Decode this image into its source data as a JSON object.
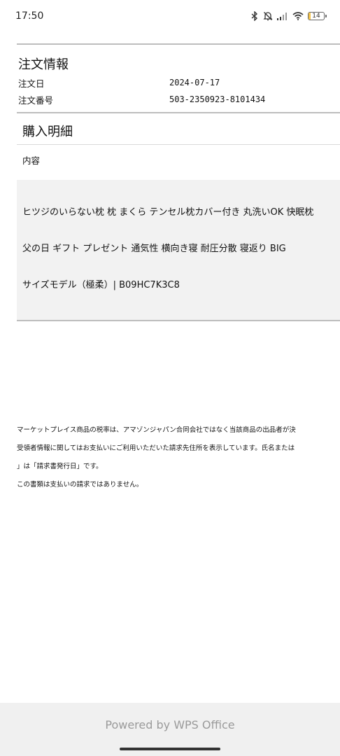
{
  "status_bar": {
    "time": "17:50",
    "battery_level": "14",
    "icons": [
      "bluetooth-icon",
      "bell-muted-icon",
      "signal-icon",
      "wifi-icon",
      "battery-icon"
    ]
  },
  "order_info": {
    "title": "注文情報",
    "order_date_label": "注文日",
    "order_date": "2024-07-17",
    "order_number_label": "注文番号",
    "order_number": "503-2350923-8101434"
  },
  "purchase_details": {
    "title": "購入明細",
    "content_label": "内容",
    "product_line1": "ヒツジのいらない枕 枕 まくら テンセル枕カバー付き 丸洗いOK 快眠枕",
    "product_line2": "父の日 ギフト プレゼント 通気性 横向き寝 耐圧分散 寝返り BIG",
    "product_line3": "サイズモデル（極柔）| B09HC7K3C8"
  },
  "notes": {
    "line1": "マーケットプレイス商品の税率は、アマゾンジャパン合同会社ではなく当該商品の出品者が決",
    "line2": "受領者情報に関してはお支払いにご利用いただいた請求先住所を表示しています。氏名または",
    "line3": "」は「請求書発行日」です。",
    "line4": "この書類は支払いの請求ではありません。"
  },
  "footer": {
    "powered_by": "Powered by WPS Office"
  }
}
